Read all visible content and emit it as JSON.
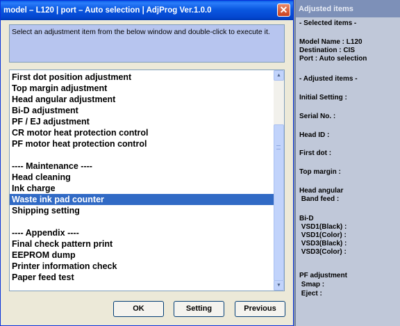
{
  "dialog": {
    "title": "model – L120  |  port – Auto selection  |  AdjProg Ver.1.0.0",
    "close_glyph": "✕",
    "instruction": "Select an adjustment item from the below window and double-click to execute it."
  },
  "list": {
    "items": [
      "First dot position adjustment",
      "Top margin adjustment",
      "Head angular adjustment",
      "Bi-D adjustment",
      "PF / EJ adjustment",
      "CR motor heat protection control",
      "PF motor heat protection control",
      "",
      "---- Maintenance ----",
      "Head cleaning",
      "Ink charge",
      "Waste ink pad counter",
      "Shipping setting",
      "",
      "---- Appendix ----",
      "Final check pattern print",
      "EEPROM dump",
      "Printer information check",
      "Paper feed test"
    ],
    "selected_index": 11
  },
  "buttons": {
    "ok": "OK",
    "setting": "Setting",
    "previous": "Previous"
  },
  "panel": {
    "title": "Adjusted items",
    "selected_header": "- Selected items -",
    "model": "Model Name : L120",
    "destination": "Destination : CIS",
    "port": "Port : Auto selection",
    "adjusted_header": "- Adjusted items -",
    "initial_setting": "Initial Setting :",
    "serial": "Serial No. :",
    "head_id": "Head ID :",
    "first_dot": "First dot :",
    "top_margin": "Top margin :",
    "head_angular": "Head angular",
    "band_feed": " Band feed :",
    "bid": "Bi-D",
    "vsd1_black": " VSD1(Black) :",
    "vsd1_color": " VSD1(Color) :",
    "vsd3_black": " VSD3(Black) :",
    "vsd3_color": " VSD3(Color) :",
    "pf_adjustment": "PF adjustment",
    "smap": " Smap :",
    "eject": " Eject :"
  }
}
